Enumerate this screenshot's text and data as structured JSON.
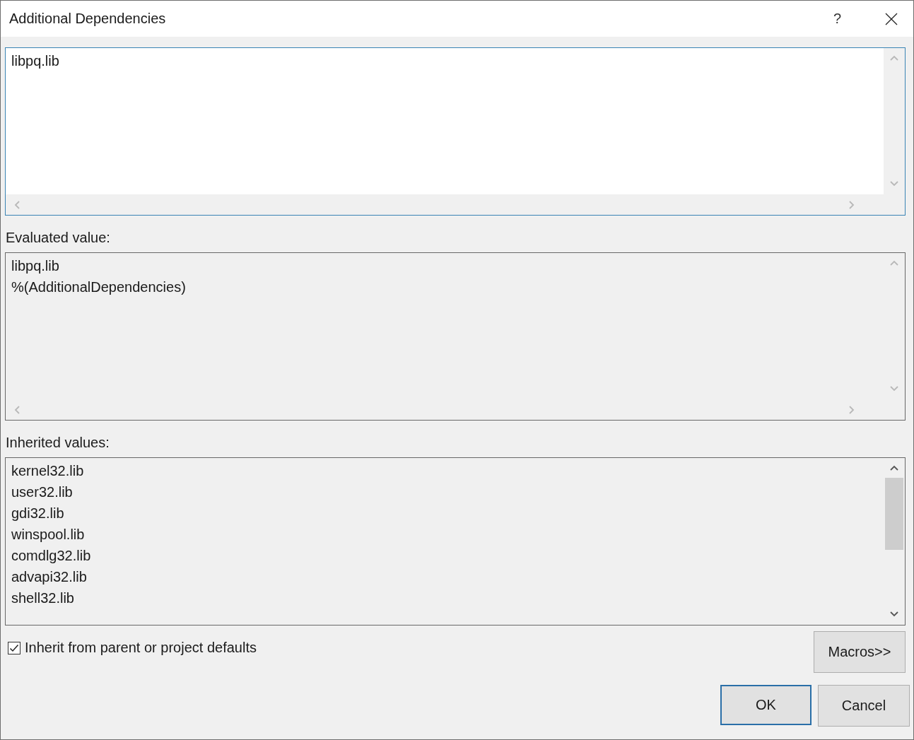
{
  "window": {
    "title": "Additional Dependencies",
    "help": "?"
  },
  "editor": {
    "focused": true,
    "lines": [
      "libpq.lib"
    ]
  },
  "evaluated": {
    "label": "Evaluated value:",
    "lines": [
      "libpq.lib",
      "%(AdditionalDependencies)"
    ]
  },
  "inherited": {
    "label": "Inherited values:",
    "lines": [
      "kernel32.lib",
      "user32.lib",
      "gdi32.lib",
      "winspool.lib",
      "comdlg32.lib",
      "advapi32.lib",
      "shell32.lib"
    ]
  },
  "inherit_checkbox": {
    "label": "Inherit from parent or project defaults",
    "checked": true
  },
  "buttons": [
    {
      "label": "Macros>>",
      "kind": "macros",
      "default": false
    },
    {
      "label": "OK",
      "kind": "confirm",
      "default": true
    },
    {
      "label": "Cancel",
      "kind": "confirm",
      "default": false
    }
  ]
}
